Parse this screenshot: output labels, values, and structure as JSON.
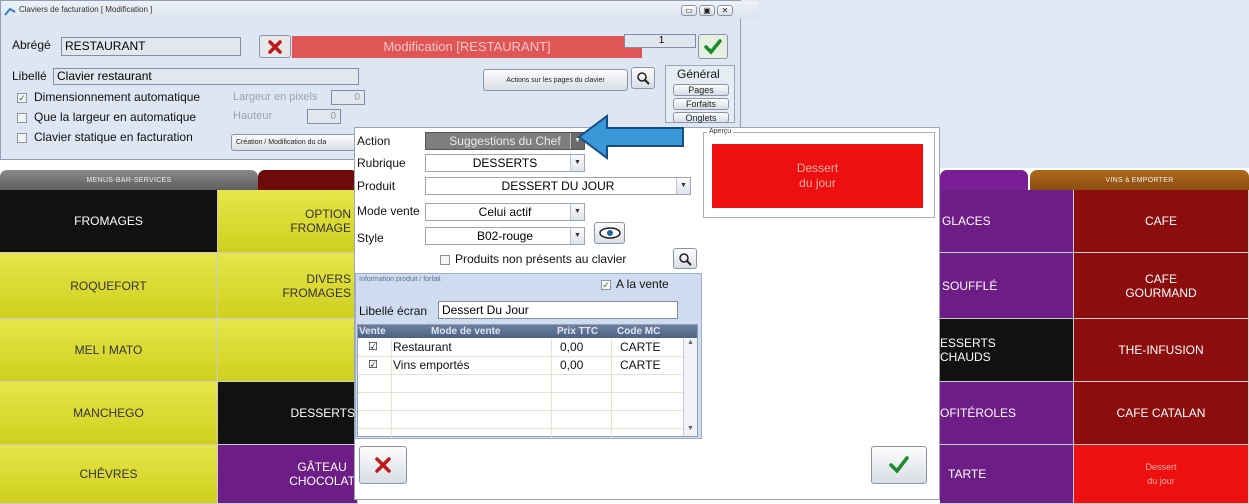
{
  "window": {
    "title": "Claviers de facturation  [ Modification ]",
    "abrege_label": "Abrégé",
    "abrege_value": "RESTAURANT",
    "counter": "1",
    "banner": "Modification [RESTAURANT]",
    "libelle_label": "Libellé",
    "libelle_value": "Clavier restaurant",
    "actions_pages_btn": "Actions sur les pages du clavier",
    "general_label": "Général",
    "pages_btn": "Pages",
    "forfaits_btn": "Forfaits",
    "onglets_btn": "Onglets",
    "check_dim_auto": "Dimensionnement automatique",
    "check_largeur_auto": "Que la largeur en automatique",
    "check_statique": "Clavier statique en facturation",
    "largeur_label": "Largeur en pixels",
    "largeur_value": "0",
    "hauteur_label": "Hauteur",
    "hauteur_value": "0",
    "creation_btn": "Création / Modification du cla"
  },
  "tabs": {
    "menus": "MENUS-BAR-SERVICES",
    "vins": "VINS à EMPORTER"
  },
  "keys": {
    "fromages": "FROMAGES",
    "option_fromage": "OPTION\nFROMAGE",
    "roquefort": "ROQUEFORT",
    "divers_fromages": "DIVERS\nFROMAGES",
    "mel_i_mato": "MEL I MATO",
    "manchego": "MANCHEGO",
    "desserts": "DESSERTS",
    "chevres": "CHÊVRES",
    "gateau_chocolat": "GÂTEAU\nCHOCOLAT",
    "glaces": "GLACES",
    "souffle": "SOUFFLÉ",
    "desserts_chauds": "ESSERTS\nCHAUDS",
    "profiteroles": "OFITÉROLES",
    "tarte": "TARTE",
    "cafe": "CAFE",
    "cafe_gourmand": "CAFE\nGOURMAND",
    "the_infusion": "THE-INFUSION",
    "cafe_catalan": "CAFE CATALAN",
    "dessert_du_jour": "Dessert\ndu jour"
  },
  "dialog": {
    "action_label": "Action",
    "action_value": "Suggestions du Chef",
    "rubrique_label": "Rubrique",
    "rubrique_value": "DESSERTS",
    "produit_label": "Produit",
    "produit_value": "DESSERT DU JOUR",
    "mode_vente_label": "Mode vente",
    "mode_vente_value": "Celui actif",
    "style_label": "Style",
    "style_value": "B02-rouge",
    "produits_non_presents": "Produits non présents au clavier",
    "info_title": "Information produit / forfait",
    "a_la_vente": "A la vente",
    "libelle_ecran_label": "Libellé écran",
    "libelle_ecran_value": "Dessert Du Jour",
    "apercu_label": "Aperçu",
    "apercu_text": "Dessert\ndu jour",
    "grid_headers": [
      "Vente",
      "Mode de vente",
      "Prix TTC",
      "Code MC"
    ],
    "grid_rows": [
      {
        "check": "☑",
        "mode": "Restaurant",
        "prix": "0,00",
        "code": "CARTE"
      },
      {
        "check": "☑",
        "mode": "Vins emportés",
        "prix": "0,00",
        "code": "CARTE"
      }
    ]
  },
  "colors": {
    "banner_red": "#e05656",
    "apercu_red": "#ee1010",
    "arrow_blue": "#3a98d8"
  }
}
